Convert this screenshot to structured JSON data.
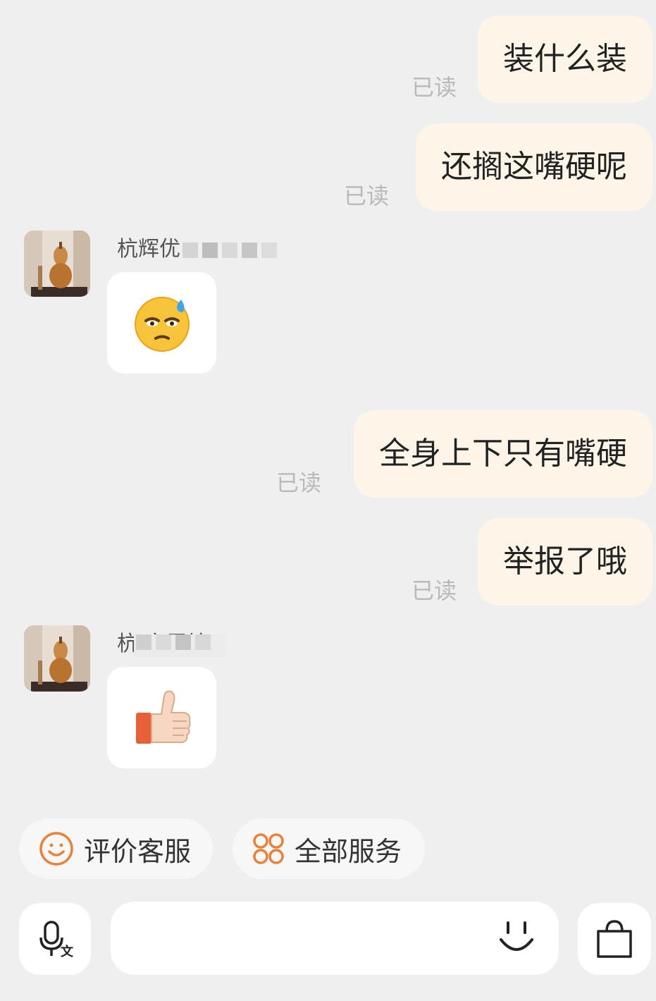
{
  "messages": [
    {
      "text": "装什么装",
      "status": "已读"
    },
    {
      "text": "还搁这嘴硬呢",
      "status": "已读"
    },
    {
      "sender": "杭辉优",
      "emoji": "downcast-face-with-sweat-emoji"
    },
    {
      "text": "全身上下只有嘴硬",
      "status": "已读"
    },
    {
      "text": "举报了哦",
      "status": "已读"
    },
    {
      "sender": "杭 家居坊",
      "emoji": "thumbs-up-emoji"
    }
  ],
  "quick_actions": [
    {
      "label": "评价客服",
      "icon": "smiley-icon"
    },
    {
      "label": "全部服务",
      "icon": "grid-services-icon"
    }
  ],
  "input": {
    "placeholder": "",
    "value": ""
  },
  "colors": {
    "bubble": "#fdf6e8",
    "accent": "#e8813a",
    "background": "#efefef"
  }
}
